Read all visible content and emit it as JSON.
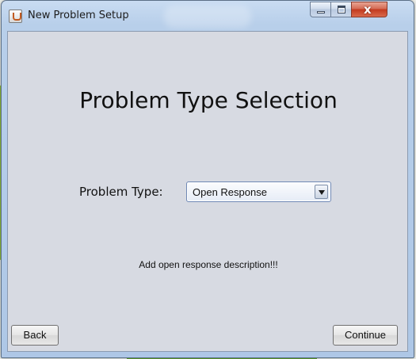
{
  "window": {
    "title": "New Problem Setup",
    "minimize_icon": "minimize-icon",
    "maximize_icon": "maximize-icon",
    "close_icon": "close-icon",
    "close_glyph": "x"
  },
  "main": {
    "heading": "Problem Type Selection",
    "problem_type_label": "Problem Type:",
    "problem_type_selected": "Open Response",
    "description": "Add open response description!!!"
  },
  "footer": {
    "back_label": "Back",
    "continue_label": "Continue"
  },
  "colors": {
    "client_background": "#d7dae2",
    "title_bar": "#c9dcf2",
    "close_button": "#c23a1e",
    "desktop_accent": "#7fb52a"
  }
}
